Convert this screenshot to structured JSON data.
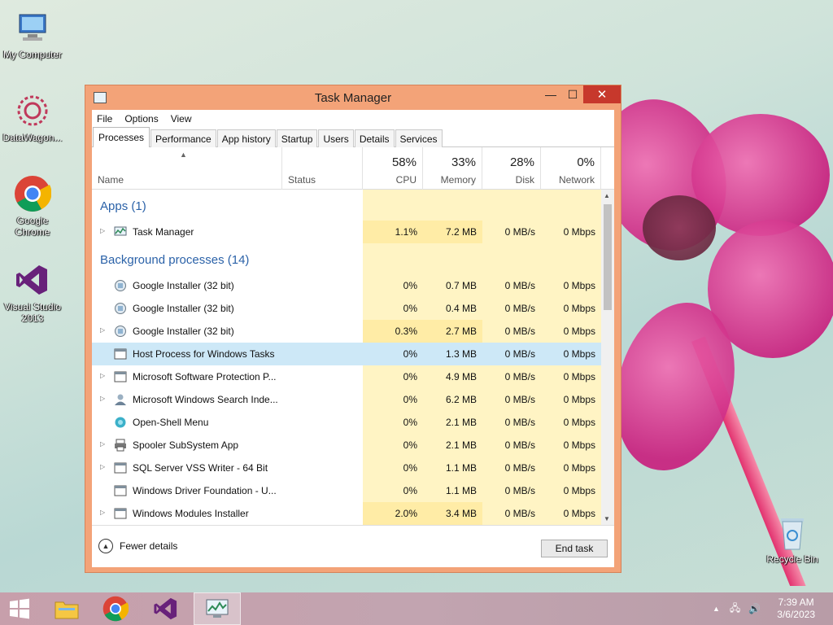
{
  "desktop": {
    "icons": [
      {
        "label": "My Computer"
      },
      {
        "label": "DataWagon..."
      },
      {
        "label": "Google Chrome"
      },
      {
        "label": "Visual Studio 2013"
      },
      {
        "label": "Recycle Bin"
      }
    ]
  },
  "window": {
    "title": "Task Manager",
    "controls": {
      "minimize": "—",
      "maximize": "☐",
      "close": "✕"
    }
  },
  "menu": [
    "File",
    "Options",
    "View"
  ],
  "tabs": [
    "Processes",
    "Performance",
    "App history",
    "Startup",
    "Users",
    "Details",
    "Services"
  ],
  "columns": {
    "name": "Name",
    "status": "Status",
    "cpu": {
      "pct": "58%",
      "label": "CPU"
    },
    "memory": {
      "pct": "33%",
      "label": "Memory"
    },
    "disk": {
      "pct": "28%",
      "label": "Disk"
    },
    "network": {
      "pct": "0%",
      "label": "Network"
    }
  },
  "groups": {
    "apps": "Apps (1)",
    "background": "Background processes (14)"
  },
  "apps": [
    {
      "name": "Task Manager",
      "cpu": "1.1%",
      "mem": "7.2 MB",
      "disk": "0 MB/s",
      "net": "0 Mbps"
    }
  ],
  "background": [
    {
      "name": "Google Installer (32 bit)",
      "cpu": "0%",
      "mem": "0.7 MB",
      "disk": "0 MB/s",
      "net": "0 Mbps"
    },
    {
      "name": "Google Installer (32 bit)",
      "cpu": "0%",
      "mem": "0.4 MB",
      "disk": "0 MB/s",
      "net": "0 Mbps"
    },
    {
      "name": "Google Installer (32 bit)",
      "cpu": "0.3%",
      "mem": "2.7 MB",
      "disk": "0 MB/s",
      "net": "0 Mbps"
    },
    {
      "name": "Host Process for Windows Tasks",
      "cpu": "0%",
      "mem": "1.3 MB",
      "disk": "0 MB/s",
      "net": "0 Mbps"
    },
    {
      "name": "Microsoft Software Protection P...",
      "cpu": "0%",
      "mem": "4.9 MB",
      "disk": "0 MB/s",
      "net": "0 Mbps"
    },
    {
      "name": "Microsoft Windows Search Inde...",
      "cpu": "0%",
      "mem": "6.2 MB",
      "disk": "0 MB/s",
      "net": "0 Mbps"
    },
    {
      "name": "Open-Shell Menu",
      "cpu": "0%",
      "mem": "2.1 MB",
      "disk": "0 MB/s",
      "net": "0 Mbps"
    },
    {
      "name": "Spooler SubSystem App",
      "cpu": "0%",
      "mem": "2.1 MB",
      "disk": "0 MB/s",
      "net": "0 Mbps"
    },
    {
      "name": "SQL Server VSS Writer - 64 Bit",
      "cpu": "0%",
      "mem": "1.1 MB",
      "disk": "0 MB/s",
      "net": "0 Mbps"
    },
    {
      "name": "Windows Driver Foundation - U...",
      "cpu": "0%",
      "mem": "1.1 MB",
      "disk": "0 MB/s",
      "net": "0 Mbps"
    },
    {
      "name": "Windows Modules Installer",
      "cpu": "2.0%",
      "mem": "3.4 MB",
      "disk": "0 MB/s",
      "net": "0 Mbps"
    }
  ],
  "footer": {
    "fewer_details": "Fewer details",
    "end_task": "End task"
  },
  "taskbar": {
    "time": "7:39 AM",
    "date": "3/6/2023"
  }
}
